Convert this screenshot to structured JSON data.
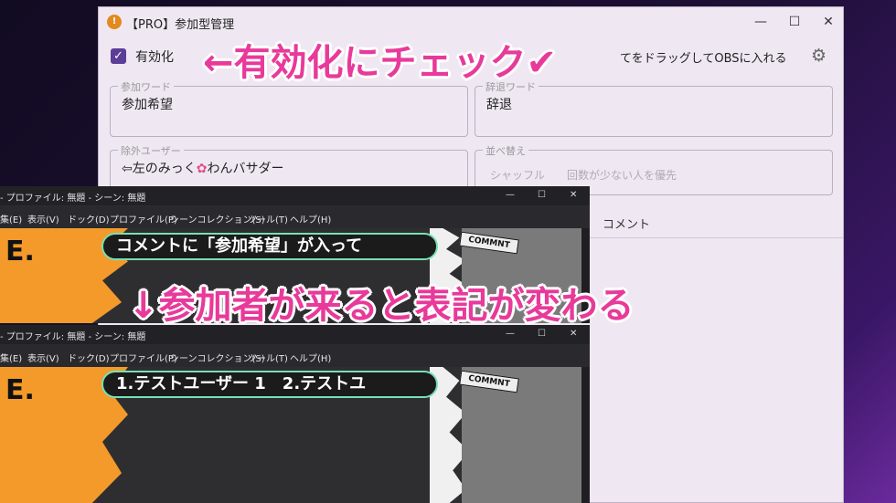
{
  "app": {
    "title": "【PRO】参加型管理",
    "icon_glyph": "!",
    "controls": {
      "minimize": "—",
      "maximize": "☐",
      "close": "✕"
    },
    "enable_label": "有効化",
    "enable_checked": true,
    "drag_hint": "てをドラッグしてOBSに入れる",
    "join_word": {
      "legend": "参加ワード",
      "value": "参加希望"
    },
    "decline_word": {
      "legend": "辞退ワード",
      "value": "辞退"
    },
    "excluded_users": {
      "legend": "除外ユーザー",
      "value_prefix": "⇦左のみっく",
      "value_suffix": "わんバサダー"
    },
    "sort": {
      "legend": "並べ替え",
      "options": [
        "シャッフル",
        "回数が少ない人を優先"
      ]
    },
    "tab_comment": "コメント"
  },
  "obs": {
    "title": "- プロファイル: 無題 - シーン: 無題",
    "menu": [
      "集(E)",
      "表示(V)",
      "ドック(D)",
      "プロファイル(P)",
      "シーンコレクション(S)",
      "ツール(T)",
      "ヘルプ(H)"
    ],
    "letter": "E.",
    "comment_tag": "COMMNT",
    "bubble_top": "コメントに「参加希望」が入って",
    "bubble_bottom": "1.テストユーザー 1　2.テストユ"
  },
  "annotations": {
    "check": "←有効化にチェック✔",
    "changes": "↓参加者が来ると表記が変わる"
  },
  "colors": {
    "accent_pink": "#e83a9a",
    "check_purple": "#5c3d97",
    "bubble_border": "#77e0b5",
    "orange": "#f39a2b"
  }
}
